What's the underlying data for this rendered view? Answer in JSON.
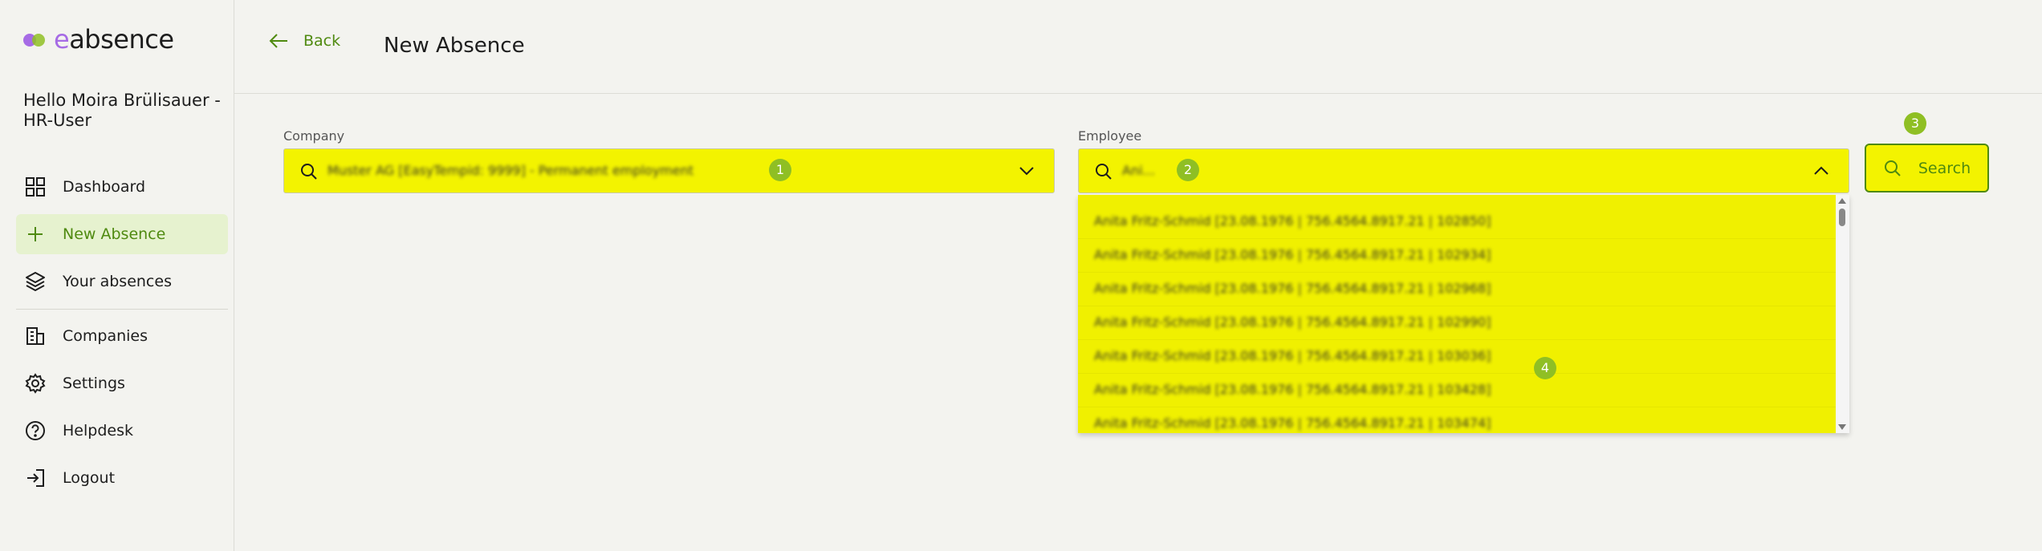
{
  "brand": {
    "name_prefix": "e",
    "name_rest": "absence"
  },
  "greeting": "Hello Moira Brülisauer - HR-User",
  "nav": {
    "dashboard": "Dashboard",
    "new_absence": "New Absence",
    "your_absences": "Your absences",
    "companies": "Companies",
    "settings": "Settings",
    "helpdesk": "Helpdesk",
    "logout": "Logout"
  },
  "header": {
    "back_label": "Back",
    "title": "New Absence"
  },
  "form": {
    "company": {
      "label": "Company",
      "value": "Muster AG [EasyTempid: 9999] - Permanent employment"
    },
    "employee": {
      "label": "Employee",
      "value": "Ani..."
    },
    "search_button": "Search"
  },
  "badges": {
    "company": "1",
    "employee": "2",
    "search": "3",
    "dropdown": "4"
  },
  "employee_options": [
    "Anita Fritz-Schmid [23.08.1976 | 756.4564.8917.21 | 102850]",
    "Anita Fritz-Schmid [23.08.1976 | 756.4564.8917.21 | 102934]",
    "Anita Fritz-Schmid [23.08.1976 | 756.4564.8917.21 | 102968]",
    "Anita Fritz-Schmid [23.08.1976 | 756.4564.8917.21 | 102990]",
    "Anita Fritz-Schmid [23.08.1976 | 756.4564.8917.21 | 103036]",
    "Anita Fritz-Schmid [23.08.1976 | 756.4564.8917.21 | 103428]",
    "Anita Fritz-Schmid [23.08.1976 | 756.4564.8917.21 | 103474]"
  ],
  "colors": {
    "accent": "#4f8a10",
    "highlight": "#f3f300",
    "badge": "#8fbf24",
    "active_nav_bg": "#e6f2cf"
  }
}
